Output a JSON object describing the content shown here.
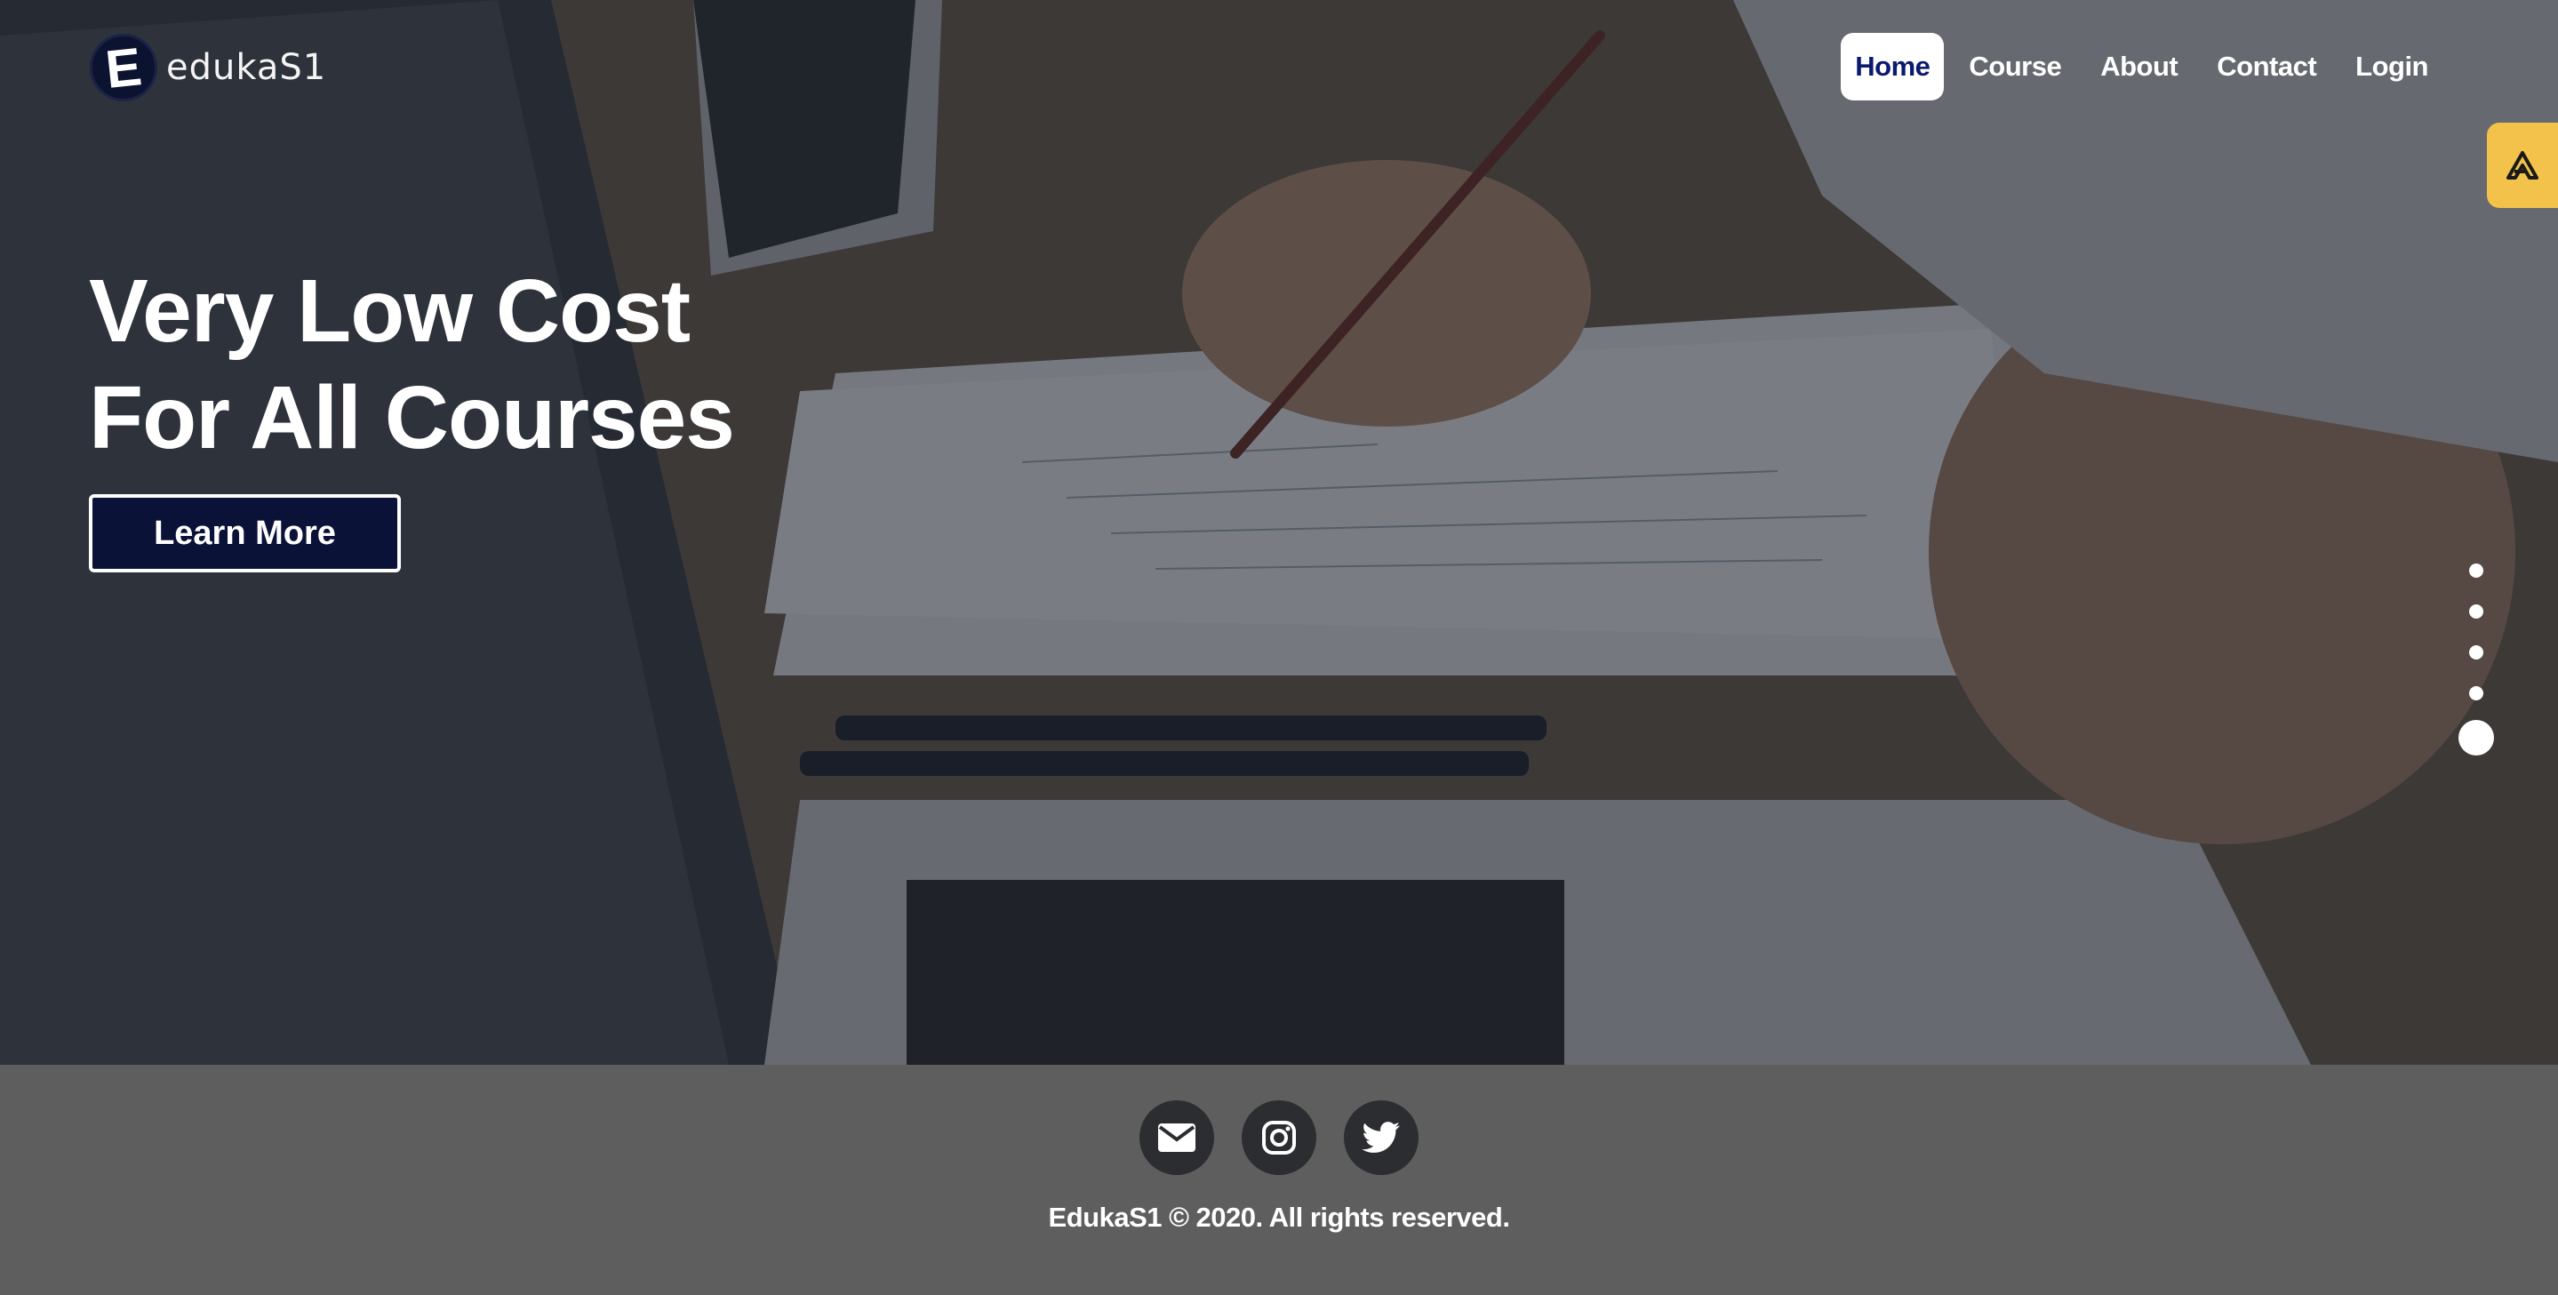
{
  "brand": {
    "logo_letter": "E",
    "name": "edukaS1"
  },
  "nav": {
    "items": [
      {
        "label": "Home",
        "active": true
      },
      {
        "label": "Course",
        "active": false
      },
      {
        "label": "About",
        "active": false
      },
      {
        "label": "Contact",
        "active": false
      },
      {
        "label": "Login",
        "active": false
      }
    ]
  },
  "hero": {
    "headline_line1": "Very Low Cost",
    "headline_line2": "For All Courses",
    "cta_label": "Learn More",
    "slides_total": 5,
    "active_slide": 5
  },
  "side_tab": {
    "icon": "accessibility-icon"
  },
  "footer": {
    "socials": [
      {
        "name": "email",
        "icon": "envelope-icon"
      },
      {
        "name": "instagram",
        "icon": "instagram-icon"
      },
      {
        "name": "twitter",
        "icon": "twitter-icon"
      }
    ],
    "copyright": "EdukaS1 © 2020. All rights reserved."
  },
  "colors": {
    "accent_navy": "#0b1238",
    "nav_active_text": "#0a1a6e",
    "side_tab": "#f2c24a",
    "footer_bg": "#5e5e5e",
    "social_bg": "#2c2d30"
  }
}
